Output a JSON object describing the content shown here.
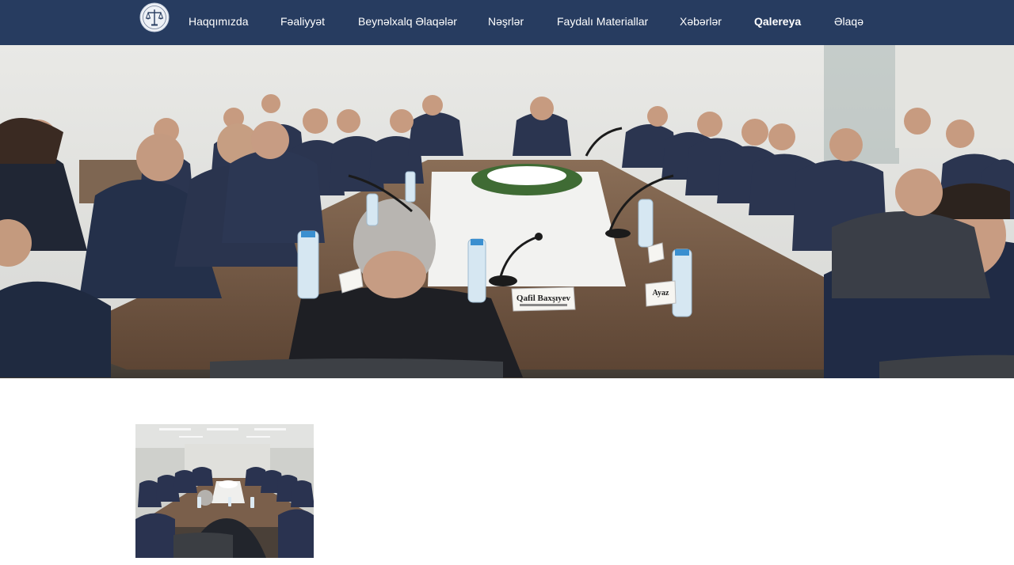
{
  "site": {
    "logo_icon": "scales-of-justice-emblem",
    "colors": {
      "navbar_bg": "#273c60",
      "nav_text": "#ffffff",
      "page_bg": "#ffffff"
    }
  },
  "nav": {
    "items": [
      {
        "label": "Haqqımızda",
        "active": false
      },
      {
        "label": "Fəaliyyət",
        "active": false
      },
      {
        "label": "Beynəlxalq Əlaqələr",
        "active": false
      },
      {
        "label": "Nəşrlər",
        "active": false
      },
      {
        "label": "Faydalı Materiallar",
        "active": false
      },
      {
        "label": "Xəbərlər",
        "active": false
      },
      {
        "label": "Qalereya",
        "active": true
      },
      {
        "label": "Əlaqə",
        "active": false
      }
    ]
  },
  "hero": {
    "nameplates": [
      "Qafil Baxşıyev",
      "Ayaz"
    ]
  },
  "gallery": {
    "thumbnail_count": 1
  }
}
